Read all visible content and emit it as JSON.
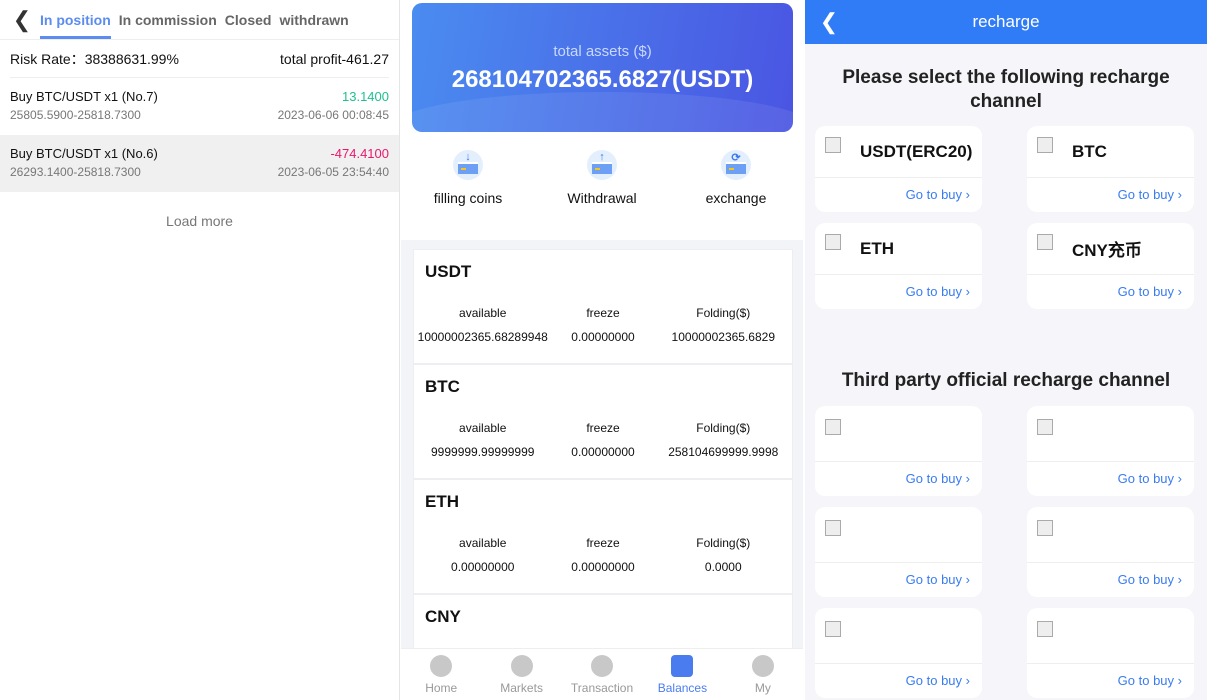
{
  "left": {
    "tabs": [
      "In position",
      "In commission",
      "Closed",
      "withdrawn"
    ],
    "risk_label": "Risk Rate：",
    "risk_value": "38388631.99%",
    "total_profit": "total profit-461.27",
    "positions": [
      {
        "title": "Buy BTC/USDT x1 (No.7)",
        "profit": "13.1400",
        "range": "25805.5900-25818.7300",
        "time": "2023-06-06 00:08:45",
        "color": "#1fbf8f"
      },
      {
        "title": "Buy BTC/USDT x1 (No.6)",
        "profit": "-474.4100",
        "range": "26293.1400-25818.7300",
        "time": "2023-06-05 23:54:40",
        "color": "#e8186e"
      }
    ],
    "load_more": "Load more"
  },
  "mid": {
    "assets_label": "total assets ($)",
    "assets_value": "268104702365.6827(USDT)",
    "actions": [
      "filling coins",
      "Withdrawal",
      "exchange"
    ],
    "col_labels": [
      "available",
      "freeze",
      "Folding($)"
    ],
    "assets": [
      {
        "name": "USDT",
        "available": "10000002365.68289948",
        "freeze": "0.00000000",
        "folding": "10000002365.6829"
      },
      {
        "name": "BTC",
        "available": "9999999.99999999",
        "freeze": "0.00000000",
        "folding": "258104699999.9998"
      },
      {
        "name": "ETH",
        "available": "0.00000000",
        "freeze": "0.00000000",
        "folding": "0.0000"
      },
      {
        "name": "CNY"
      }
    ],
    "nav": [
      "Home",
      "Markets",
      "Transaction",
      "Balances",
      "My"
    ]
  },
  "right": {
    "title": "recharge",
    "section1": "Please select the following recharge channel",
    "channels": [
      "USDT(ERC20)",
      "BTC",
      "ETH",
      "CNY充币"
    ],
    "go": "Go to buy",
    "section2": "Third party official recharge channel"
  }
}
